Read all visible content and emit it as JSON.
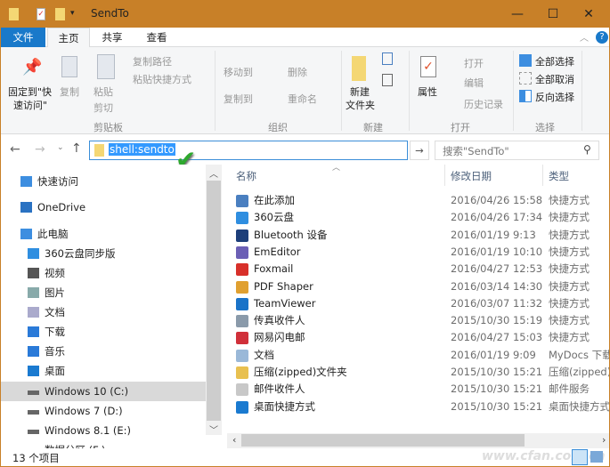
{
  "window": {
    "title": "SendTo",
    "minimize": "—",
    "maximize": "☐",
    "close": "✕",
    "accent": "#c88028"
  },
  "tabs": [
    {
      "label": "文件"
    },
    {
      "label": "主页"
    },
    {
      "label": "共享"
    },
    {
      "label": "查看"
    }
  ],
  "ribbon": {
    "clipboard": {
      "pin": "固定到\"快",
      "pin2": "速访问\"",
      "copy": "复制",
      "paste": "粘贴",
      "copy_path": "复制路径",
      "paste_shortcut": "粘贴快捷方式",
      "cut": "剪切",
      "label": "剪贴板"
    },
    "organize": {
      "move_to": "移动到",
      "copy_to": "复制到",
      "delete": "删除",
      "rename": "重命名",
      "label": "组织"
    },
    "new": {
      "new_folder": "新建",
      "new_folder2": "文件夹",
      "label": "新建"
    },
    "open": {
      "properties": "属性",
      "open": "打开",
      "edit": "编辑",
      "history": "历史记录",
      "label": "打开"
    },
    "select": {
      "select_all": "全部选择",
      "select_none": "全部取消",
      "invert": "反向选择",
      "label": "选择"
    }
  },
  "address": {
    "value": "shell:sendto",
    "search_placeholder": "搜索\"SendTo\""
  },
  "nav": [
    {
      "label": "快速访问",
      "icon": "star-icon",
      "indent": 0
    },
    {
      "label": "OneDrive",
      "icon": "onedrive-icon",
      "indent": 0
    },
    {
      "label": "此电脑",
      "icon": "computer-icon",
      "indent": 0
    },
    {
      "label": "360云盘同步版",
      "icon": "cloud-icon",
      "indent": 1
    },
    {
      "label": "视频",
      "icon": "video-icon",
      "indent": 1
    },
    {
      "label": "图片",
      "icon": "picture-icon",
      "indent": 1
    },
    {
      "label": "文档",
      "icon": "document-icon",
      "indent": 1
    },
    {
      "label": "下载",
      "icon": "download-icon",
      "indent": 1
    },
    {
      "label": "音乐",
      "icon": "music-icon",
      "indent": 1
    },
    {
      "label": "桌面",
      "icon": "desktop-icon",
      "indent": 1
    },
    {
      "label": "Windows 10 (C:)",
      "icon": "drive-icon",
      "indent": 1,
      "selected": true
    },
    {
      "label": "Windows 7 (D:)",
      "icon": "drive-icon",
      "indent": 1
    },
    {
      "label": "Windows 8.1 (E:)",
      "icon": "drive-icon",
      "indent": 1
    },
    {
      "label": "数据分区 (F:)",
      "icon": "drive-icon",
      "indent": 1
    }
  ],
  "columns": {
    "name": "名称",
    "date": "修改日期",
    "type": "类型"
  },
  "files": [
    {
      "name": " 在此添加",
      "date": "2016/04/26 15:58",
      "type": "快捷方式",
      "color": "#4a7fc0"
    },
    {
      "name": "360云盘",
      "date": "2016/04/26 17:34",
      "type": "快捷方式",
      "color": "#2f8ee0"
    },
    {
      "name": "Bluetooth 设备",
      "date": "2016/01/19 9:13",
      "type": "快捷方式",
      "color": "#1d3f7a"
    },
    {
      "name": "EmEditor",
      "date": "2016/01/19 10:10",
      "type": "快捷方式",
      "color": "#6b5fb5"
    },
    {
      "name": "Foxmail",
      "date": "2016/04/27 12:53",
      "type": "快捷方式",
      "color": "#d8302a"
    },
    {
      "name": "PDF Shaper",
      "date": "2016/03/14 14:30",
      "type": "快捷方式",
      "color": "#e0a030"
    },
    {
      "name": "TeamViewer",
      "date": "2016/03/07 11:32",
      "type": "快捷方式",
      "color": "#1a73c8"
    },
    {
      "name": "传真收件人",
      "date": "2015/10/30 15:19",
      "type": "快捷方式",
      "color": "#8a9aaa"
    },
    {
      "name": "网易闪电邮",
      "date": "2016/04/27 15:03",
      "type": "快捷方式",
      "color": "#d0303a"
    },
    {
      "name": "文档",
      "date": "2016/01/19 9:09",
      "type": "MyDocs 下载",
      "color": "#9ab8d8"
    },
    {
      "name": "压缩(zipped)文件夹",
      "date": "2015/10/30 15:21",
      "type": "压缩(zipped)文件夹",
      "color": "#e8c050"
    },
    {
      "name": "邮件收件人",
      "date": "2015/10/30 15:21",
      "type": "邮件服务",
      "color": "#c8c8c8"
    },
    {
      "name": "桌面快捷方式",
      "date": "2015/10/30 15:21",
      "type": "桌面快捷方式",
      "color": "#1a7ad0"
    }
  ],
  "status": {
    "count": "13 个项目"
  },
  "watermark": "www.cfan.com.cn"
}
